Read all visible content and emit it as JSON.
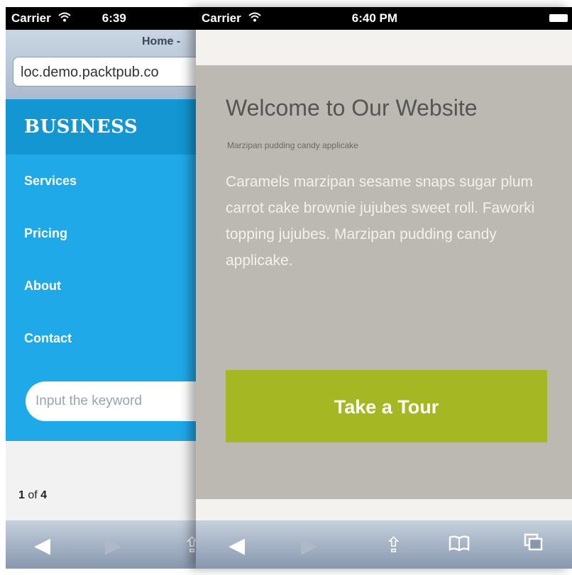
{
  "left_phone": {
    "status": {
      "carrier": "Carrier",
      "time": "6:39"
    },
    "page_title": "Home -",
    "url": "loc.demo.packtpub.co",
    "brand": "BUSINESS",
    "menu": [
      "Services",
      "Pricing",
      "About",
      "Contact"
    ],
    "search_placeholder": "Input the keyword",
    "pager": {
      "current": "1",
      "of": "of",
      "total": "4"
    }
  },
  "right_phone": {
    "status": {
      "carrier": "Carrier",
      "time": "6:40 PM"
    },
    "hero": {
      "title": "Welcome to Our Website",
      "subtitle": "Marzipan pudding candy applicake",
      "body": "Caramels marzipan sesame snaps sugar plum carrot cake brownie jujubes sweet roll. Faworki topping jujubes. Marzipan pudding candy applicake.",
      "cta": "Take a Tour"
    }
  },
  "colors": {
    "menu": "#1fa9e8",
    "brand_bar": "#1496d3",
    "cta": "#a5b722",
    "hero_bg": "#bcb8b2"
  },
  "icons": {
    "back": "◀",
    "forward": "▶",
    "share": "⇪",
    "bookmarks": "⌧",
    "tabs": "⧉",
    "wifi": "wifi-icon"
  }
}
